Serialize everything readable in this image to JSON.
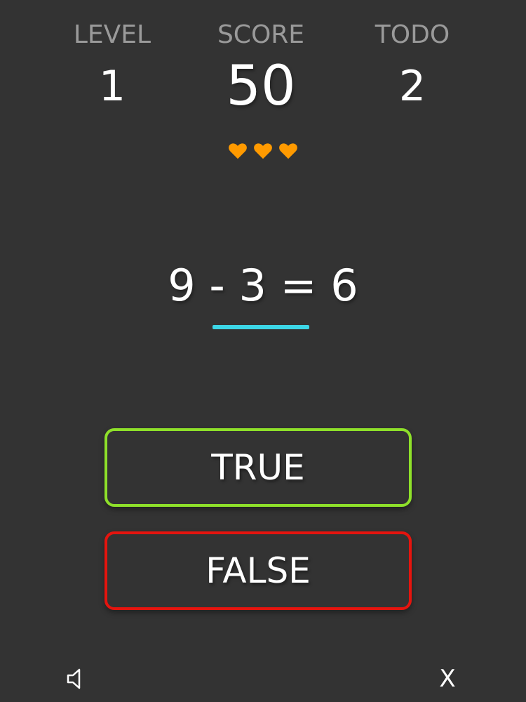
{
  "stats": {
    "level": {
      "label": "LEVEL",
      "value": "1"
    },
    "score": {
      "label": "SCORE",
      "value": "50"
    },
    "todo": {
      "label": "TODO",
      "value": "2"
    }
  },
  "lives": {
    "count": 3,
    "icon": "heart-icon",
    "color": "#ff9a00"
  },
  "question": {
    "equation": "9 - 3 = 6"
  },
  "timer": {
    "remaining_fraction": 1.0,
    "color": "#3cd6e6"
  },
  "answers": {
    "true_label": "TRUE",
    "true_color": "#8ee02a",
    "false_label": "FALSE",
    "false_color": "#e5140e"
  },
  "controls": {
    "sound_icon": "speaker-icon",
    "close_label": "X"
  }
}
